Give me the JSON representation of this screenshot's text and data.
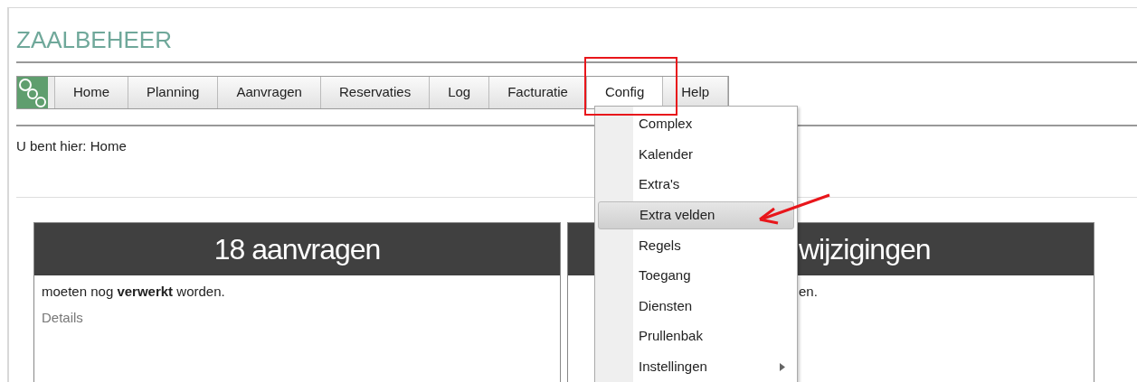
{
  "header": {
    "title": "ZAALBEHEER"
  },
  "nav": {
    "tabs": [
      {
        "label": "Home",
        "selected": false
      },
      {
        "label": "Planning",
        "selected": false
      },
      {
        "label": "Aanvragen",
        "selected": false
      },
      {
        "label": "Reservaties",
        "selected": false
      },
      {
        "label": "Log",
        "selected": false
      },
      {
        "label": "Facturatie",
        "selected": false
      },
      {
        "label": "Config",
        "selected": true
      },
      {
        "label": "Help",
        "selected": false
      }
    ]
  },
  "breadcrumb": "U bent hier: Home",
  "cards": [
    {
      "title": "18 aanvragen",
      "text": "moeten nog **verwerkt** worden.",
      "link": "Details"
    },
    {
      "title": "wijzigingen",
      "text": "en."
    }
  ],
  "menu": {
    "items": [
      {
        "label": "Complex",
        "selected": false,
        "kind": "item"
      },
      {
        "label": "Kalender",
        "selected": false,
        "kind": "item"
      },
      {
        "label": "Extra's",
        "selected": false,
        "kind": "item"
      },
      {
        "label": "Extra velden",
        "selected": true,
        "kind": "item"
      },
      {
        "label": "Regels",
        "selected": false,
        "kind": "item"
      },
      {
        "label": "Toegang",
        "selected": false,
        "kind": "item"
      },
      {
        "label": "Diensten",
        "selected": false,
        "kind": "item"
      },
      {
        "label": "Prullenbak",
        "selected": false,
        "kind": "item"
      },
      {
        "label": "Instellingen",
        "selected": false,
        "kind": "submenu"
      }
    ]
  }
}
